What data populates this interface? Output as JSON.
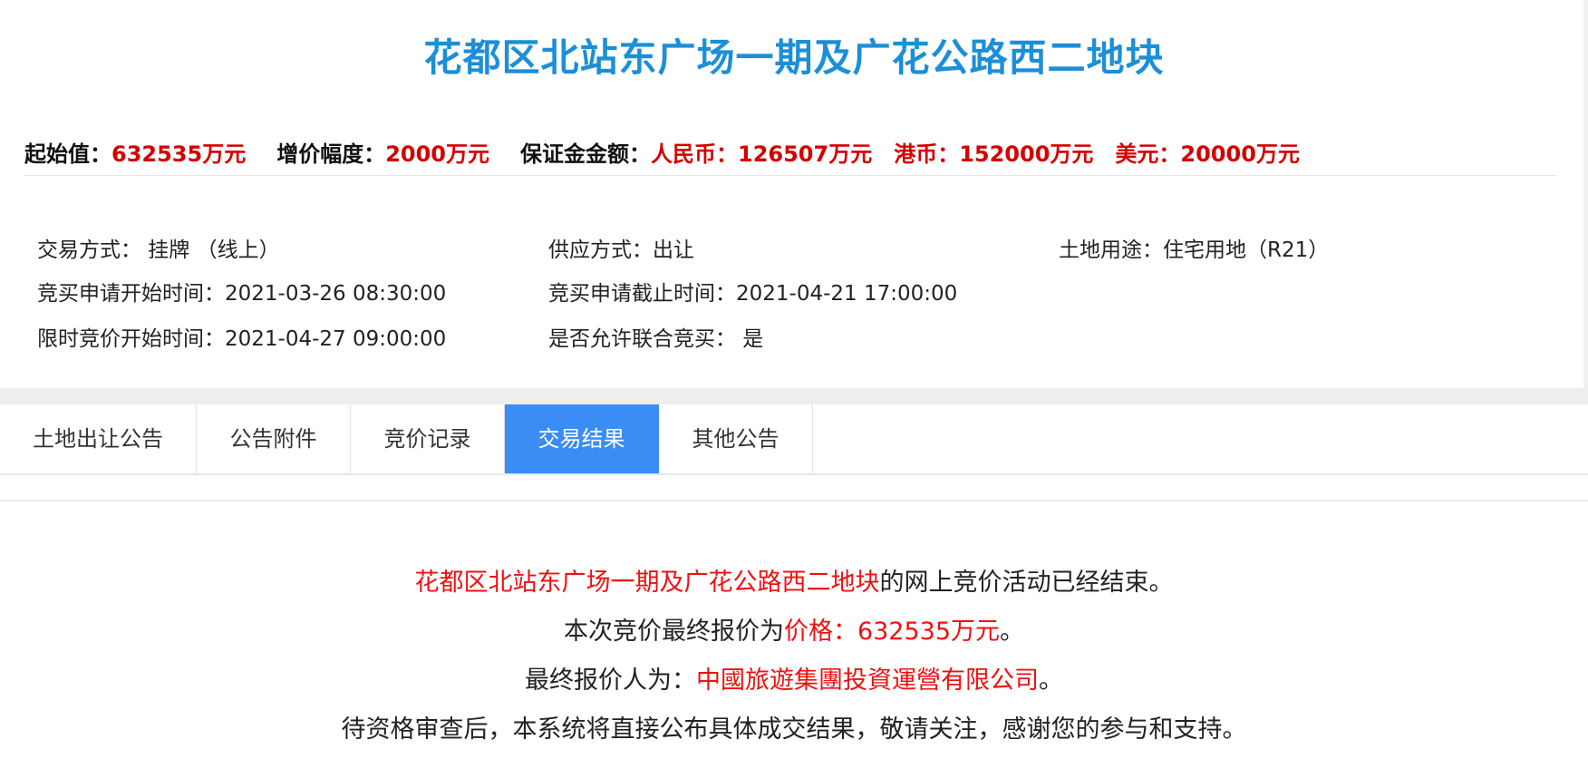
{
  "title": "花都区北站东广场一期及广花公路西二地块",
  "summary": {
    "start_label": "起始值：",
    "start_value": "632535万元",
    "increment_label": "增价幅度：",
    "increment_value": "2000万元",
    "deposit_label": "保证金金额：",
    "rmb_label": "人民币：",
    "rmb_value": "126507万元",
    "hkd_label": "港币：",
    "hkd_value": "152000万元",
    "usd_label": "美元：",
    "usd_value": "20000万元"
  },
  "info": {
    "trade_method": "交易方式：  挂牌 （线上）",
    "supply_method": "供应方式：出让",
    "land_use": "土地用途：住宅用地（R21）",
    "apply_start": "竞买申请开始时间：2021-03-26 08:30:00",
    "apply_end": "竞买申请截止时间：2021-04-21 17:00:00",
    "bid_start": "限时竞价开始时间：2021-04-27 09:00:00",
    "joint_bid": "是否允许联合竞买：  是"
  },
  "tabs": [
    {
      "label": "土地出让公告"
    },
    {
      "label": "公告附件"
    },
    {
      "label": "竞价记录"
    },
    {
      "label": "交易结果",
      "active": true
    },
    {
      "label": "其他公告"
    }
  ],
  "result": {
    "line1_name": "花都区北站东广场一期及广花公路西二地块",
    "line1_text": "的网上竞价活动已经结束。",
    "line2_prefix": "本次竞价最终报价为",
    "line2_price": "价格：632535万元",
    "line2_suffix": "。",
    "line3_prefix": "最终报价人为：",
    "line3_company": "中國旅遊集團投資運營有限公司",
    "line3_suffix": "。",
    "line4": "待资格审查后，本系统将直接公布具体成交结果，敬请关注，感谢您的参与和支持。"
  },
  "colors": {
    "title": "#1b8fd8",
    "highlight_red": "#d40000",
    "tab_active": "#3b8cf5"
  }
}
